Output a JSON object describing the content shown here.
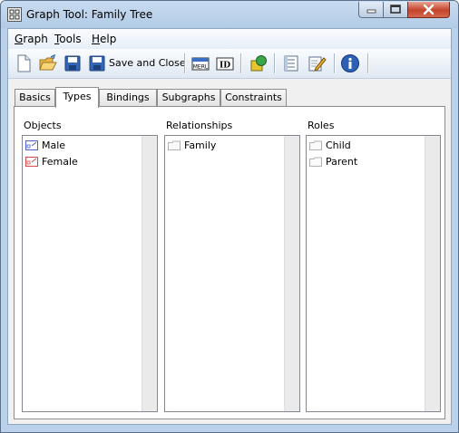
{
  "window": {
    "title": "Graph Tool: Family Tree"
  },
  "menu": [
    {
      "label": "Graph",
      "mnemonic": "G",
      "rest": "raph"
    },
    {
      "label": "Tools",
      "mnemonic": "T",
      "rest": "ools"
    },
    {
      "label": "Help",
      "mnemonic": "H",
      "rest": "elp"
    }
  ],
  "toolbar": {
    "save_close_label": "Save and Close",
    "icons": [
      "new-file-icon",
      "open-folder-icon",
      "save-icon",
      "save-and-close-icon",
      "merl-icon",
      "id-icon",
      "shapes-icon",
      "list-view-icon",
      "edit-icon",
      "info-icon"
    ]
  },
  "tabs": [
    {
      "label": "Basics",
      "active": false
    },
    {
      "label": "Types",
      "active": true
    },
    {
      "label": "Bindings",
      "active": false
    },
    {
      "label": "Subgraphs",
      "active": false
    },
    {
      "label": "Constraints",
      "active": false
    }
  ],
  "types": {
    "objects": {
      "label": "Objects",
      "items": [
        {
          "label": "Male",
          "icon": "male-object-icon",
          "color": "#4a5fd0"
        },
        {
          "label": "Female",
          "icon": "female-object-icon",
          "color": "#d84a4a"
        }
      ]
    },
    "relationships": {
      "label": "Relationships",
      "items": [
        {
          "label": "Family",
          "icon": "relationship-icon"
        }
      ]
    },
    "roles": {
      "label": "Roles",
      "items": [
        {
          "label": "Child",
          "icon": "role-icon"
        },
        {
          "label": "Parent",
          "icon": "role-icon"
        }
      ]
    }
  }
}
